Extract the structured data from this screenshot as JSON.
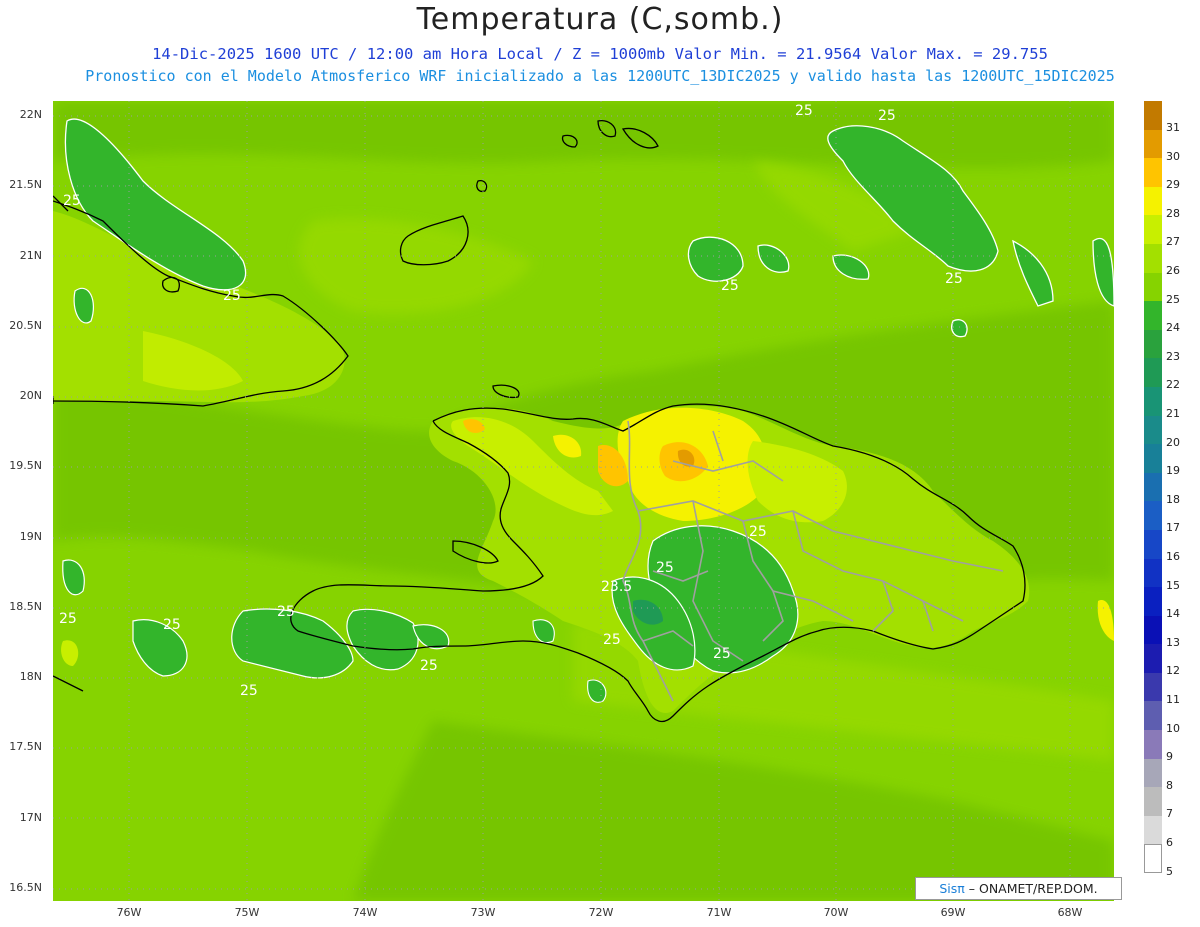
{
  "header": {
    "title": "Temperatura (C,somb.)",
    "line1": "14-Dic-2025 1600 UTC / 12:00 am Hora Local / Z = 1000mb   Valor Min. = 21.9564  Valor Max. = 29.755",
    "line2": "Pronostico con el Modelo Atmosferico WRF inicializado a las 1200UTC_13DIC2025 y valido hasta las  1200UTC_15DIC2025"
  },
  "axes": {
    "y_labels": [
      "22N",
      "21.5N",
      "21N",
      "20.5N",
      "20N",
      "19.5N",
      "19N",
      "18.5N",
      "18N",
      "17.5N",
      "17N",
      "16.5N"
    ],
    "x_labels": [
      "76W",
      "75W",
      "74W",
      "73W",
      "72W",
      "71W",
      "70W",
      "69W",
      "68W"
    ]
  },
  "colorbar": {
    "labels": [
      "31",
      "30",
      "29",
      "28",
      "27",
      "26",
      "25",
      "24",
      "23",
      "22",
      "21",
      "20",
      "19",
      "18",
      "17",
      "16",
      "15",
      "14",
      "13",
      "12",
      "11",
      "10",
      "9",
      "8",
      "7",
      "6",
      "5"
    ],
    "colors": [
      "#c27a00",
      "#e39b00",
      "#ffc400",
      "#f5f200",
      "#c8ef00",
      "#a3e000",
      "#86d300",
      "#33b52b",
      "#2aa23d",
      "#1f9a55",
      "#199475",
      "#1a8b8a",
      "#188098",
      "#1a6fb0",
      "#1b5ec5",
      "#1747c7",
      "#1132c4",
      "#0a20c0",
      "#0a10b5",
      "#1c1cb0",
      "#3a39ad",
      "#5e5eb0",
      "#8a7ab8",
      "#a7a7b8",
      "#bcbcbc",
      "#dadada",
      "#ffffff"
    ]
  },
  "contour_labels": [
    "25",
    "25",
    "25",
    "25",
    "25",
    "25",
    "25",
    "25",
    "25",
    "25",
    "25",
    "25",
    "25",
    "25",
    "23.5",
    "25"
  ],
  "credit": {
    "sis": "Sisπ",
    "rest": " – ONAMET/REP.DOM."
  }
}
